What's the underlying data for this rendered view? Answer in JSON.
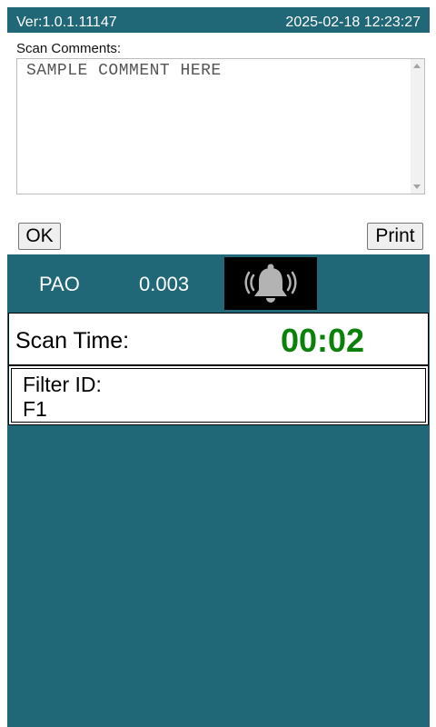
{
  "header": {
    "version": "Ver:1.0.1.11147",
    "datetime": "2025-02-18 12:23:27"
  },
  "comments": {
    "label": "Scan Comments:",
    "value": "SAMPLE COMMENT HERE"
  },
  "buttons": {
    "ok": "OK",
    "print": "Print"
  },
  "reading": {
    "label": "PAO",
    "value": "0.003",
    "alarm_icon": "bell-ringing-icon"
  },
  "scan_time": {
    "label": "Scan Time:",
    "value": "00:02",
    "value_color": "#0a820a"
  },
  "filter": {
    "label": "Filter ID:",
    "value": "F1"
  },
  "colors": {
    "accent": "#206778"
  }
}
